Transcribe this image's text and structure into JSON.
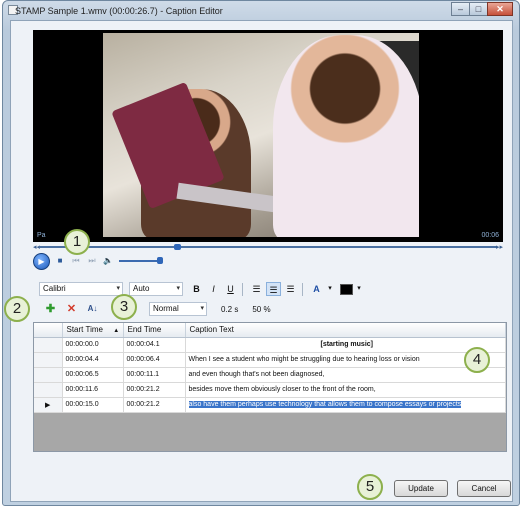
{
  "window": {
    "title": "STAMP Sample 1.wmv (00:00:26.7) - Caption Editor",
    "controls": [
      "minimize",
      "maximize",
      "close"
    ]
  },
  "video": {
    "time_left": "Pa",
    "time_right": "00:06",
    "progress_fraction": 0.3
  },
  "transport": {
    "icons": [
      "play-icon",
      "stop-icon",
      "prev-icon",
      "next-icon",
      "volume-icon"
    ],
    "volume_fraction": 1.0
  },
  "format_toolbar": {
    "font": "Calibri",
    "size": "Auto",
    "bold": "B",
    "italic": "I",
    "underline": "U",
    "font_color_label": "A"
  },
  "edit_toolbar": {
    "style": "Normal",
    "duration": "0.2 s",
    "opacity": "50 %"
  },
  "table": {
    "columns": [
      "Start Time",
      "End Time",
      "Caption Text"
    ],
    "rows": [
      {
        "start": "00:00:00.0",
        "end": "00:00:04.1",
        "text": "[starting music]",
        "current": false
      },
      {
        "start": "00:00:04.4",
        "end": "00:00:06.4",
        "text": "When I see a student who might be struggling due to hearing loss or vision",
        "current": false
      },
      {
        "start": "00:00:06.5",
        "end": "00:00:11.1",
        "text": "and even though that's not been diagnosed,",
        "current": false
      },
      {
        "start": "00:00:11.6",
        "end": "00:00:21.2",
        "text": "besides move them obviously closer to the front of the room,",
        "current": false
      },
      {
        "start": "00:00:15.0",
        "end": "00:00:21.2",
        "text": "also have them perhaps use technology that allows them to compose essays or projects",
        "current": true
      }
    ]
  },
  "buttons": {
    "update": "Update",
    "cancel": "Cancel"
  },
  "callouts": [
    "1",
    "2",
    "3",
    "4",
    "5"
  ],
  "colors": {
    "selection": "#3a74c9",
    "callout_border": "#8db04d",
    "callout_fill": "#e8f1d7"
  }
}
